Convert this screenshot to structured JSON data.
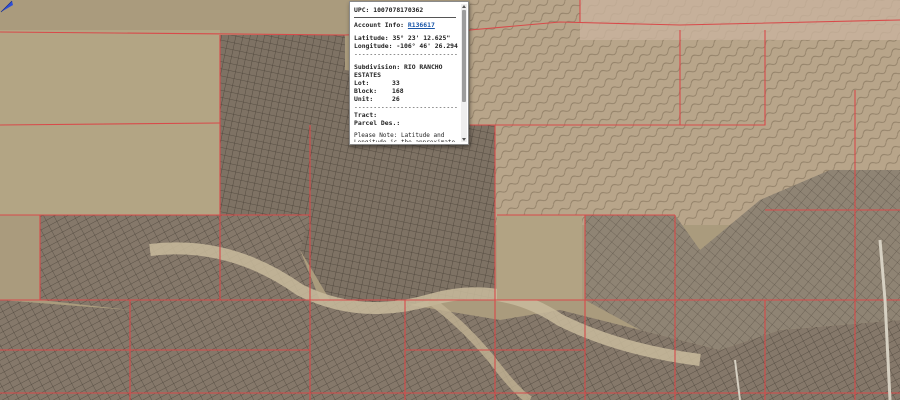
{
  "map": {
    "basemap": "aerial-imagery",
    "parcel_line_color": "#d84a4a",
    "lot_line_color": "#5a5246"
  },
  "popup": {
    "upc": "UPC: 1007078170362",
    "account_label": "Account Info:",
    "account_link": "R136617",
    "latitude": "Latitude: 35° 23' 12.625\"",
    "longitude": "Longitude: -106° 46' 26.294\"",
    "divider": "------------------------------",
    "subdivision_label": "Subdivision:",
    "subdivision_value": "RIO RANCHO",
    "subdivision_value_2": "ESTATES",
    "fields": [
      {
        "label": "Lot:",
        "value": "33"
      },
      {
        "label": "Block:",
        "value": "168"
      },
      {
        "label": "Unit:",
        "value": "26"
      }
    ],
    "tract_label": "Tract:",
    "parcel_des_label": "Parcel Des.:",
    "note": "Please Note: Latitude and Longitude is the approximate center of the parcel shown."
  }
}
